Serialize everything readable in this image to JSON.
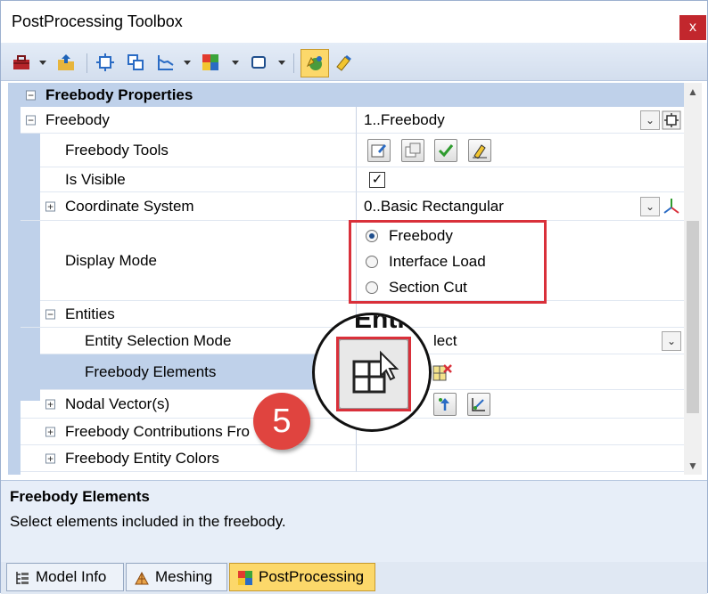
{
  "window": {
    "title": "PostProcessing Toolbox",
    "close_glyph": "x"
  },
  "toolbar": {
    "buttons": [
      "toolbox-icon",
      "open-icon",
      "freebody-icon",
      "group-icon",
      "graph-icon",
      "contour-icon",
      "box-icon",
      "freebody-tool-icon",
      "pen-icon"
    ]
  },
  "grid": {
    "section_title": "Freebody Properties",
    "freebody": {
      "label": "Freebody",
      "value": "1..Freebody"
    },
    "freebody_tools": {
      "label": "Freebody Tools"
    },
    "is_visible": {
      "label": "Is Visible",
      "checked": true,
      "check_glyph": "✓"
    },
    "coordinate_system": {
      "label": "Coordinate System",
      "value": "0..Basic Rectangular"
    },
    "display_mode": {
      "label": "Display Mode",
      "options": [
        "Freebody",
        "Interface Load",
        "Section Cut"
      ],
      "selected": "Freebody"
    },
    "entities": {
      "label": "Entities"
    },
    "entity_selection_mode": {
      "label": "Entity Selection Mode",
      "value": "lect"
    },
    "freebody_elements": {
      "label": "Freebody Elements"
    },
    "nodal_vectors": {
      "label": "Nodal Vector(s)"
    },
    "contributions": {
      "label": "Freebody Contributions Fro"
    },
    "entity_colors": {
      "label": "Freebody Entity Colors"
    },
    "expander_minus": "−",
    "expander_plus": "+",
    "dropdown_glyph": "⌄"
  },
  "description": {
    "title": "Freebody Elements",
    "text": "Select elements included in the freebody."
  },
  "tabs": [
    {
      "label": "Model Info",
      "active": false
    },
    {
      "label": "Meshing",
      "active": false
    },
    {
      "label": "PostProcessing",
      "active": true
    }
  ],
  "callout": {
    "step": "5",
    "partial_text": "Enti"
  },
  "colors": {
    "highlight": "#d9303a",
    "badge": "#e0443f",
    "section": "#bfd1ea",
    "active_tab": "#fcd86a"
  }
}
